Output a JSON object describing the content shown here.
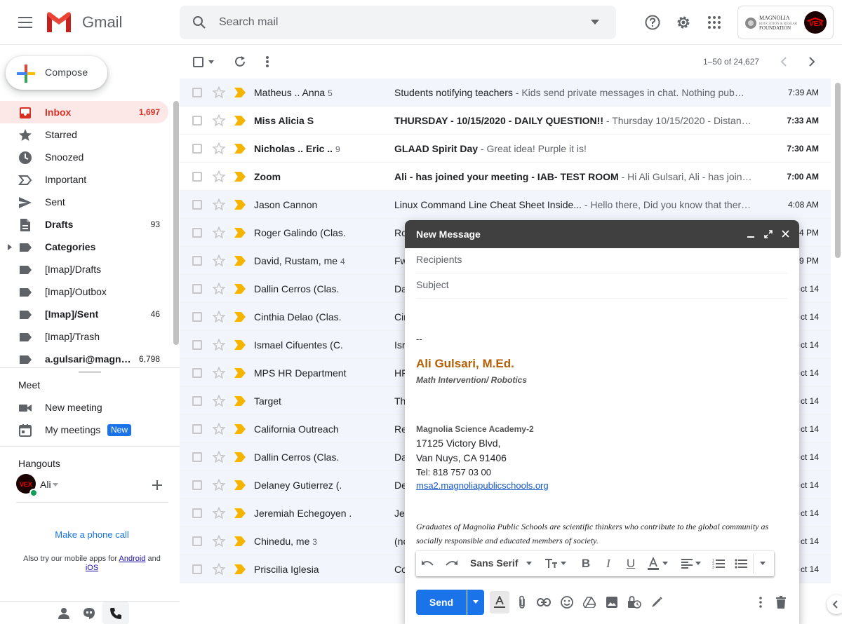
{
  "header": {
    "app_name": "Gmail",
    "search_placeholder": "Search mail",
    "account_org_logo": "MAGNOLIA EDUCATION & RESEARCH FOUNDATION",
    "account_avatar_text": "VEX"
  },
  "sidebar": {
    "compose_label": "Compose",
    "items": [
      {
        "label": "Inbox",
        "count": "1,697",
        "icon": "inbox-icon",
        "active": true
      },
      {
        "label": "Starred",
        "count": "",
        "icon": "star-icon"
      },
      {
        "label": "Snoozed",
        "count": "",
        "icon": "clock-icon"
      },
      {
        "label": "Important",
        "count": "",
        "icon": "label-important-icon"
      },
      {
        "label": "Sent",
        "count": "",
        "icon": "send-icon"
      },
      {
        "label": "Drafts",
        "count": "93",
        "icon": "draft-icon",
        "bold": true
      },
      {
        "label": "Categories",
        "count": "",
        "icon": "label-icon",
        "bold": true
      },
      {
        "label": "[Imap]/Drafts",
        "count": "",
        "icon": "label-icon"
      },
      {
        "label": "[Imap]/Outbox",
        "count": "",
        "icon": "label-icon"
      },
      {
        "label": "[Imap]/Sent",
        "count": "46",
        "icon": "label-icon",
        "bold": true
      },
      {
        "label": "[Imap]/Trash",
        "count": "",
        "icon": "label-icon"
      },
      {
        "label": "a.gulsari@magn…",
        "count": "6,798",
        "icon": "label-icon",
        "bold": true
      }
    ],
    "meet": {
      "title": "Meet",
      "new_meeting": "New meeting",
      "my_meetings": "My meetings",
      "new_badge": "New"
    },
    "hangouts": {
      "title": "Hangouts",
      "user": "Ali",
      "phone_call": "Make a phone call",
      "mobile_prefix": "Also try our mobile apps for",
      "android": "Android",
      "and": "and",
      "ios": "iOS"
    }
  },
  "toolbar": {
    "pagination": "1–50 of 24,627"
  },
  "emails": [
    {
      "sender": "Matheus .. Anna",
      "count": "5",
      "subject": "Students notifying teachers",
      "snippet": " - Kids send private messages in chat. Nothing pub…",
      "time": "7:39 AM",
      "unread": false
    },
    {
      "sender": "Miss Alicia S",
      "count": "",
      "subject": "THURSDAY - 10/15/2020 - DAILY QUESTION!!",
      "snippet": " - Thursday 10/15/2020 - Distan…",
      "time": "7:33 AM",
      "unread": true
    },
    {
      "sender": "Nicholas .. Eric ..",
      "count": "9",
      "subject": "GLAAD Spirit Day",
      "snippet": " - Great idea! Purple it is!",
      "time": "7:30 AM",
      "unread": true
    },
    {
      "sender": "Zoom",
      "count": "",
      "subject": "Ali - has joined your meeting - IAB- TEST ROOM",
      "snippet": " - Hi Ali Gulsari, Ali - has joine…",
      "time": "7:00 AM",
      "unread": true
    },
    {
      "sender": "Jason Cannon",
      "count": "",
      "subject": "Linux Command Line Cheat Sheet Inside...",
      "snippet": " - Hello there, Did you know that ther…",
      "time": "4:08 AM",
      "unread": false
    },
    {
      "sender": "Roger Galindo (Clas.",
      "count": "",
      "subject": "Ro",
      "snippet": "",
      "time": "4 PM",
      "unread": false
    },
    {
      "sender": "David, Rustam, me",
      "count": "4",
      "subject": "Fw",
      "snippet": "",
      "time": "9 PM",
      "unread": false
    },
    {
      "sender": "Dallin Cerros (Clas.",
      "count": "",
      "subject": "Da",
      "snippet": "",
      "time": "ct 14",
      "unread": false
    },
    {
      "sender": "Cinthia Delao (Clas.",
      "count": "",
      "subject": "Cir",
      "snippet": "",
      "time": "ct 14",
      "unread": false
    },
    {
      "sender": "Ismael Cifuentes (C.",
      "count": "",
      "subject": "Isr",
      "snippet": "",
      "time": "ct 14",
      "unread": false
    },
    {
      "sender": "MPS HR Department",
      "count": "",
      "subject": "HF",
      "snippet": "",
      "time": "ct 14",
      "unread": false
    },
    {
      "sender": "Target",
      "count": "",
      "subject": "Th",
      "snippet": "",
      "time": "ct 14",
      "unread": false
    },
    {
      "sender": "California Outreach",
      "count": "",
      "subject": "Re",
      "snippet": "",
      "time": "ct 14",
      "unread": false
    },
    {
      "sender": "Dallin Cerros (Clas.",
      "count": "",
      "subject": "Da",
      "snippet": "",
      "time": "ct 14",
      "unread": false
    },
    {
      "sender": "Delaney Gutierrez (.",
      "count": "",
      "subject": "De",
      "snippet": "",
      "time": "ct 14",
      "unread": false
    },
    {
      "sender": "Jeremiah Echegoyen .",
      "count": "",
      "subject": "Je",
      "snippet": "",
      "time": "ct 14",
      "unread": false
    },
    {
      "sender": "Chinedu, me",
      "count": "3",
      "subject": "(no",
      "snippet": "",
      "time": "ct 14",
      "unread": false
    },
    {
      "sender": "Priscilia Iglesia",
      "count": "",
      "subject": "Co",
      "snippet": "",
      "time": "ct 14",
      "unread": false
    }
  ],
  "compose_window": {
    "title": "New Message",
    "recipients_placeholder": "Recipients",
    "subject_placeholder": "Subject",
    "signature": {
      "dashes": "--",
      "name": "Ali Gulsari, M.Ed.",
      "role": "Math Intervention/ Robotics",
      "school": "Magnolia Science Academy-2",
      "address1": "17125 Victory Blvd,",
      "address2": "Van Nuys, CA 91406",
      "phone": "Tel: 818 757 03 00",
      "website": "msa2.magnoliapublicschools.org",
      "motto": "Graduates of Magnolia Public Schools are scientific thinkers who contribute to the global community as socially responsible and educated members of society."
    },
    "font_select": "Sans Serif",
    "send_label": "Send"
  },
  "colors": {
    "accent_red": "#d93025",
    "inbox_bg": "#fce8e6",
    "send_blue": "#1a73e8",
    "important_yellow": "#f4b400",
    "signature_name": "#b45f06"
  }
}
